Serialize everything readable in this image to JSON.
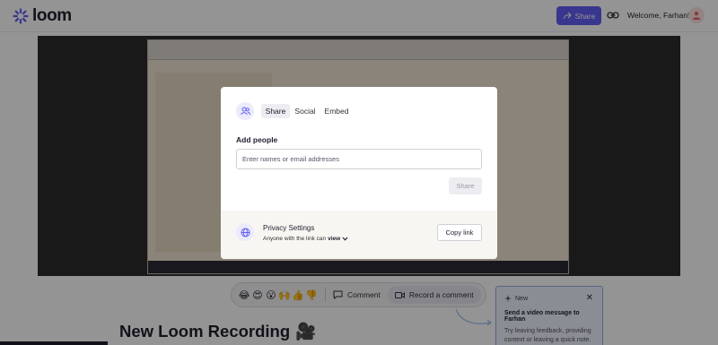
{
  "app": {
    "logo_text": "loom"
  },
  "header": {
    "share_label": "Share",
    "welcome_text": "Welcome, Farhan!"
  },
  "reactions": {
    "emojis": [
      "😂",
      "😍",
      "😮",
      "🙌",
      "👍",
      "👎"
    ],
    "comment_label": "Comment",
    "record_label": "Record a comment"
  },
  "new_card": {
    "badge": "New",
    "title": "Send a video message to Farhan",
    "body": "Try leaving feedback, providing context or leaving a quick note."
  },
  "page": {
    "title": "New Loom Recording",
    "title_emoji": "🎥"
  },
  "modal": {
    "tabs": {
      "share": "Share",
      "social": "Social",
      "embed": "Embed"
    },
    "add_people_label": "Add people",
    "input_placeholder": "Enter names or email addresses",
    "share_button": "Share",
    "privacy": {
      "title": "Privacy Settings",
      "subtitle_prefix": "Anyone with the link can",
      "permission": "view",
      "copy_link": "Copy link"
    }
  },
  "colors": {
    "accent": "#625df5",
    "overlay": "rgba(0,0,0,0.42)"
  }
}
